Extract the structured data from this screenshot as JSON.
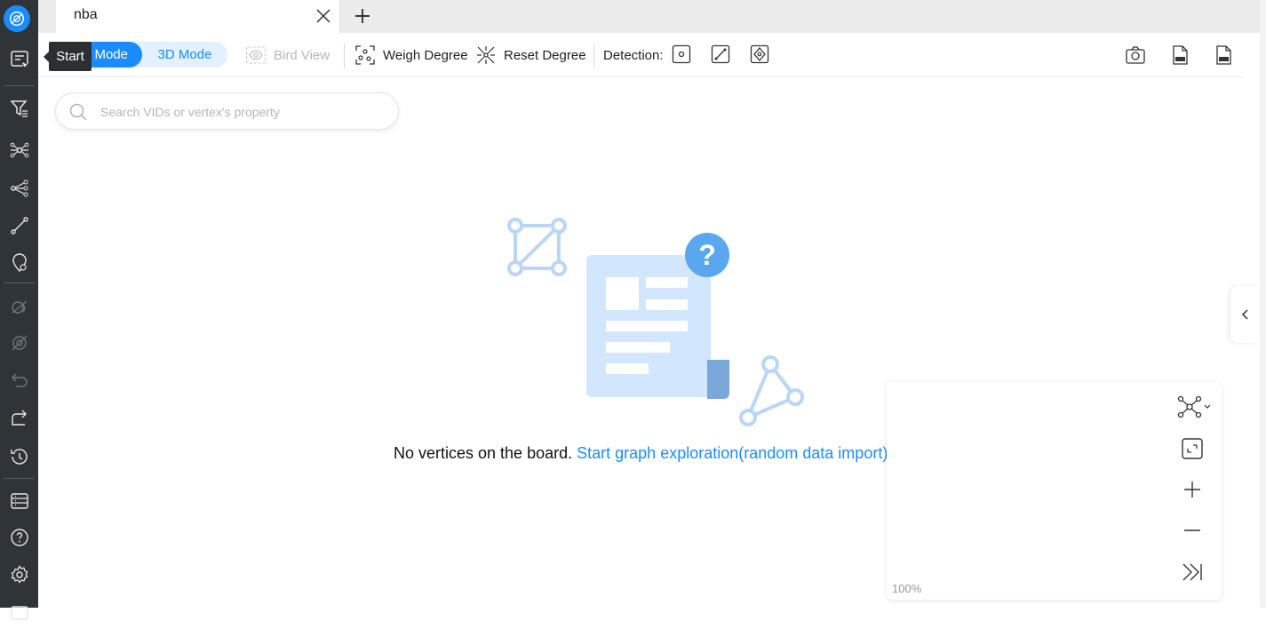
{
  "app": {
    "tab_title": "nba"
  },
  "tooltip": {
    "text": "Start"
  },
  "toolbar": {
    "mode_2d": "Mode",
    "mode_3d": "3D Mode",
    "bird_view": "Bird View",
    "weigh_degree": "Weigh Degree",
    "reset_degree": "Reset Degree",
    "detection_label": "Detection:"
  },
  "search": {
    "placeholder": "Search VIDs or vertex's property"
  },
  "empty_state": {
    "message": "No vertices on the board.",
    "link": "Start graph exploration(random data import)"
  },
  "minimap": {
    "zoom": "100%"
  },
  "colors": {
    "accent": "#1a8cff",
    "sidebar": "#2f3439"
  }
}
